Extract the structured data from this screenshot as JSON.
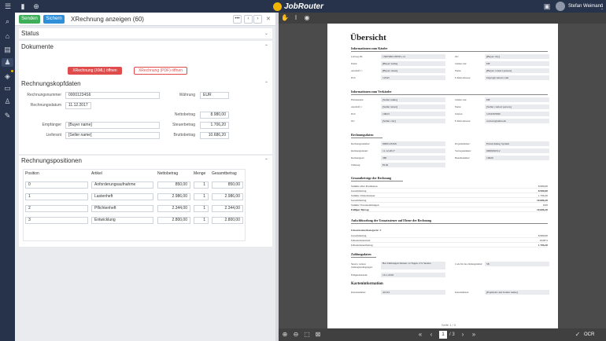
{
  "app": {
    "brand": "JobRouter",
    "user_name": "Stefan Weimann"
  },
  "header": {
    "send_label": "Senden",
    "save_label": "Sichern",
    "title": "XRechnung anzeigen (60)",
    "more_label": "•••",
    "prev_label": "‹",
    "next_label": "›",
    "close_label": "✕"
  },
  "sections": {
    "status": "Status",
    "documents": "Dokumente",
    "invoice_head": "Rechnungskopfdaten",
    "positions": "Rechnungspositionen"
  },
  "documents": {
    "xml_button": "XRechnung (XML) öffnen",
    "pdf_button": "XRechnung (PDF) öffnen"
  },
  "invoice": {
    "number_label": "Rechnungsnummer",
    "number": "00001234S6",
    "date_label": "Rechnungsdatum",
    "date": "11.12.2017",
    "currency_label": "Währung",
    "currency": "EUR",
    "net_label": "Nettobetrag",
    "net": "8.980,00",
    "tax_label": "Steuerbetrag",
    "tax": "1.706,20",
    "gross_label": "Bruttobetrag",
    "gross": "10.686,20",
    "recipient_label": "Empfänger",
    "recipient": "[Buyer name]",
    "supplier_label": "Lieferant",
    "supplier": "[Seller name]"
  },
  "positions": {
    "columns": [
      "Position",
      "Artikel",
      "Nettobetrag",
      "Menge",
      "Gesamtbetrag"
    ],
    "rows": [
      {
        "pos": "0",
        "article": "Anforderungsaufnahme",
        "net": "850,00",
        "qty": "1",
        "total": "850,00"
      },
      {
        "pos": "1",
        "article": "Lastenheft",
        "net": "2.986,00",
        "qty": "1",
        "total": "2.986,00"
      },
      {
        "pos": "2",
        "article": "Pflichtenheft",
        "net": "2.344,00",
        "qty": "1",
        "total": "2.344,00"
      },
      {
        "pos": "3",
        "article": "Entwicklung",
        "net": "2.800,00",
        "qty": "1",
        "total": "2.800,00"
      }
    ]
  },
  "viewer": {
    "page_current": "1",
    "page_total": "/ 3",
    "page_label": "Seite 1 / 3",
    "ocr_label": "OCR"
  },
  "document": {
    "title": "Übersicht",
    "buyer_section": "Informationen zum Käufer",
    "buyer_fields": [
      {
        "label": "Leitweg-ID:",
        "value": "13003002-98765-14"
      },
      {
        "label": "Name:",
        "value": "[Buyer name]"
      },
      {
        "label": "Anschrift 1:",
        "value": "[Buyer street]"
      },
      {
        "label": "PLZ:",
        "value": "12345"
      }
    ],
    "buyer_fields_right": [
      {
        "label": "Ort:",
        "value": "[Buyer city]"
      },
      {
        "label": "Ländercode:",
        "value": "DE"
      },
      {
        "label": "Name:",
        "value": "[Buyer contact person]"
      },
      {
        "label": "E-Mail-Adresse:",
        "value": "buyer@contact.com"
      }
    ],
    "seller_section": "Informationen zum Verkäufer",
    "seller_fields": [
      {
        "label": "Firmenname:",
        "value": "[Seller name]"
      },
      {
        "label": "Anschrift 1:",
        "value": "[Seller street]"
      },
      {
        "label": "PLZ:",
        "value": "10623"
      },
      {
        "label": "Ort:",
        "value": "[Seller city]"
      }
    ],
    "seller_fields_right": [
      {
        "label": "Ländercode:",
        "value": "DE"
      },
      {
        "label": "Name:",
        "value": "[Seller contact person]"
      },
      {
        "label": "Telefon:",
        "value": "1234567890"
      },
      {
        "label": "E-Mail-Adresse:",
        "value": "contact@seller.de"
      }
    ],
    "invoice_section": "Rechnungsdaten",
    "invoice_fields": [
      {
        "label": "Rechnungsnummer:",
        "value": "00001234S6"
      },
      {
        "label": "Rechnungsdatum:",
        "value": "11.12.2017"
      },
      {
        "label": "Rechnungsart:",
        "value": "380"
      },
      {
        "label": "Währung:",
        "value": "EUR"
      }
    ],
    "invoice_fields_right": [
      {
        "label": "Projektnummer:",
        "value": "Entwicklung System"
      },
      {
        "label": "Vertragsnummer:",
        "value": "0000002312"
      },
      {
        "label": "Bestellnummer:",
        "value": "10620"
      }
    ],
    "totals_section": "Gesamtbeträge der Rechnung",
    "totals": [
      {
        "label": "Summe aller Positionen",
        "value": "8.980,00"
      },
      {
        "label": "Gesamtbetrag",
        "value": "8.980,00"
      },
      {
        "label": "Summe Umsatzsteuer",
        "value": "1.706,20"
      },
      {
        "label": "Gesamtbetrag",
        "value": "10.686,20"
      },
      {
        "label": "Summe Vorauszahlungen",
        "value": "0,00"
      },
      {
        "label": "Fälliger Betrag",
        "value": "10.686,20"
      }
    ],
    "vat_section": "Aufschlüsselung der Umsatzsteuer auf Ebene der Rechnung",
    "vat_category": "Umsatzsteuerkategorie: S",
    "vat_rows": [
      {
        "label": "Gesamtbetrag",
        "value": "8.980,00"
      },
      {
        "label": "Umsatzsteuersatz",
        "value": "19,00%"
      },
      {
        "label": "Umsatzsteuerbetrag",
        "value": "1.706,20"
      }
    ],
    "payment_section": "Zahlungsdaten",
    "payment_terms_label": "Skonto; weitere Zahlungsbedingungen:",
    "payment_terms": "Bei Zahlungen binnen 14 Tagen, 2% Skonto",
    "due_date_label": "Fälligkeitsdatum:",
    "due_date": "10.1.2018",
    "code_label": "Code für das Zahlungsmittel:",
    "code_value": "58",
    "card_section": "Karteninformation",
    "card_number_label": "Kartennummer:",
    "card_number": "41234",
    "card_holder_label": "Karteninhaber:",
    "card_holder": "[Payment card holder name]"
  }
}
